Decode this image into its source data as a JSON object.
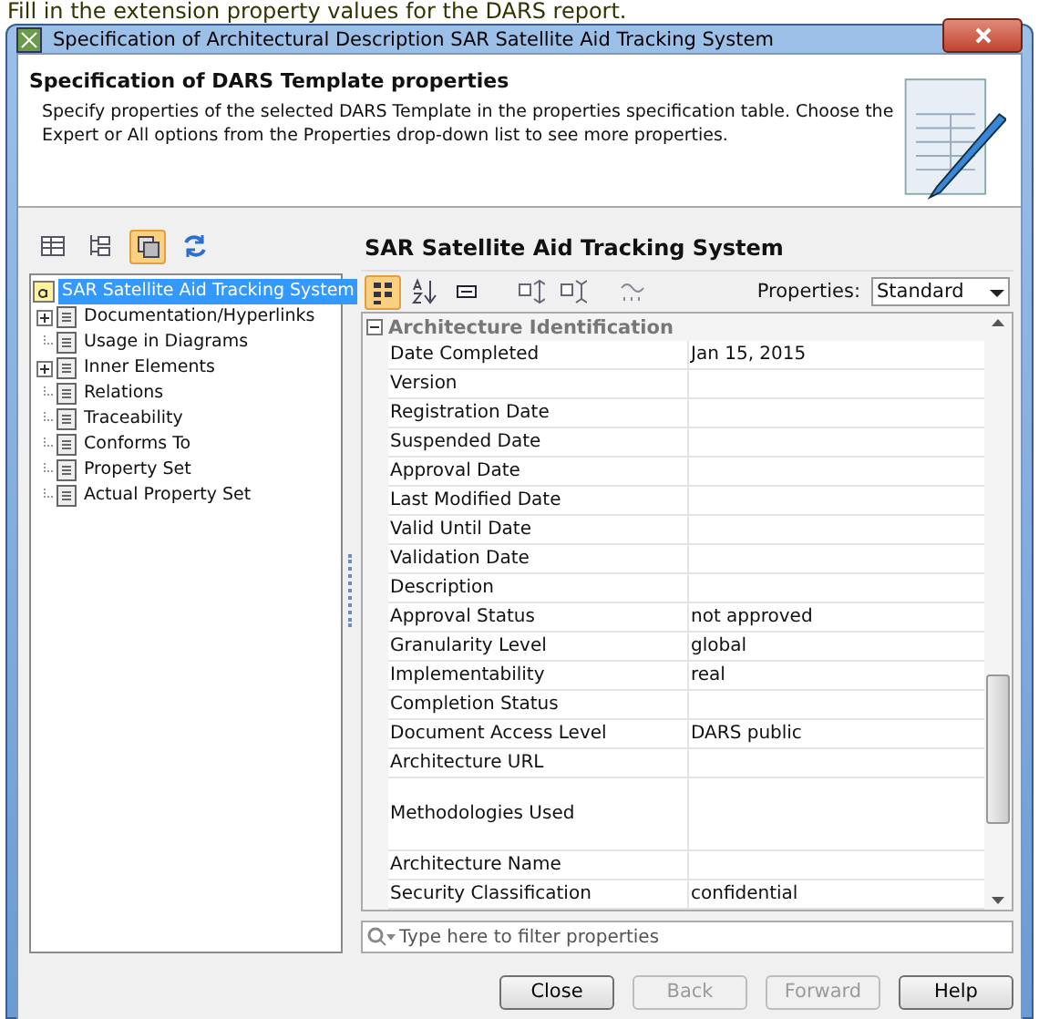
{
  "caption": "Fill in the extension property values for the DARS report.",
  "window": {
    "title": "Specification of Architectural Description SAR Satellite Aid Tracking System"
  },
  "header": {
    "title": "Specification of DARS Template properties",
    "description": "Specify properties of the selected DARS Template in the properties specification table. Choose the Expert or All options from the Properties drop-down list to see more properties."
  },
  "left_toolbar": [
    {
      "selected": false
    },
    {
      "selected": false
    },
    {
      "selected": true
    },
    {
      "selected": false
    }
  ],
  "tree": [
    {
      "label": "SAR Satellite Aid Tracking System",
      "selected": true,
      "children": [
        {
          "label": "Documentation/Hyperlinks",
          "kind": "group",
          "selected": false
        },
        {
          "label": "Usage in Diagrams",
          "kind": "leaf",
          "selected": false
        },
        {
          "label": "Inner Elements",
          "kind": "group",
          "selected": false
        },
        {
          "label": "Relations",
          "kind": "leaf",
          "selected": false
        },
        {
          "label": "Traceability",
          "kind": "leaf",
          "selected": false
        },
        {
          "label": "Conforms To",
          "kind": "leaf",
          "selected": false
        },
        {
          "label": "Property Set",
          "kind": "leaf",
          "selected": false
        },
        {
          "label": "Actual Property Set",
          "kind": "leaf",
          "selected": false
        }
      ]
    }
  ],
  "panel_title": "SAR Satellite Aid Tracking System",
  "table_toolbar": [
    {
      "selected": true
    },
    {
      "selected": false
    },
    {
      "selected": false
    },
    {
      "selected": false
    },
    {
      "selected": false
    },
    {
      "selected": false
    }
  ],
  "properties_filter": {
    "label": "Properties:",
    "value": "Standard"
  },
  "group": {
    "label": "Architecture Identification",
    "expanded": true
  },
  "rows": [
    {
      "name": "Date Completed",
      "value": "Jan 15, 2015",
      "kind": "single"
    },
    {
      "name": "Version",
      "kind": "single"
    },
    {
      "name": "Registration Date",
      "kind": "single"
    },
    {
      "name": "Suspended Date",
      "kind": "single"
    },
    {
      "name": "Approval Date",
      "kind": "single"
    },
    {
      "name": "Last Modified Date",
      "kind": "single"
    },
    {
      "name": "Valid Until Date",
      "kind": "single"
    },
    {
      "name": "Validation Date",
      "kind": "single"
    },
    {
      "name": "Description",
      "kind": "single"
    },
    {
      "name": "Approval Status",
      "value": "not approved",
      "kind": "single"
    },
    {
      "name": "Granularity Level",
      "value": "global",
      "kind": "single"
    },
    {
      "name": "Implementability",
      "value": "real",
      "kind": "single"
    },
    {
      "name": "Completion Status",
      "kind": "single"
    },
    {
      "name": "Document Access Level",
      "value": "DARS public",
      "kind": "single"
    },
    {
      "name": "Architecture URL",
      "kind": "single"
    },
    {
      "name": "Methodologies Used",
      "kind": "multiline"
    },
    {
      "name": "Architecture Name",
      "kind": "single"
    },
    {
      "name": "Security Classification",
      "value": "confidential",
      "kind": "single"
    }
  ],
  "filter": {
    "placeholder": "Type here to filter properties"
  },
  "buttons": [
    {
      "label": "Close",
      "disabled": false
    },
    {
      "label": "Back",
      "disabled": true
    },
    {
      "label": "Forward",
      "disabled": true
    },
    {
      "label": "Help",
      "disabled": false
    }
  ]
}
